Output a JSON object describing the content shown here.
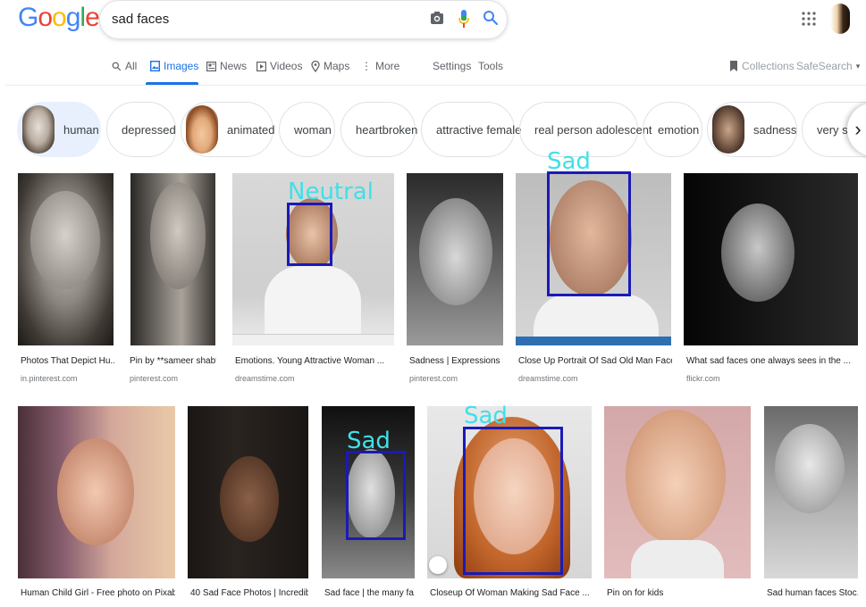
{
  "header": {
    "logo_letters": [
      "G",
      "o",
      "o",
      "g",
      "l",
      "e"
    ],
    "logo_colors": [
      "#4285f4",
      "#ea4335",
      "#fbbc05",
      "#4285f4",
      "#34a853",
      "#ea4335"
    ],
    "query": "sad faces",
    "icons": [
      "camera-icon",
      "microphone-icon",
      "search-icon",
      "apps-grid-icon"
    ]
  },
  "nav": {
    "all": "All",
    "images": "Images",
    "news": "News",
    "videos": "Videos",
    "maps": "Maps",
    "more": "More",
    "settings": "Settings",
    "tools": "Tools",
    "collections": "Collections",
    "safesearch": "SafeSearch",
    "more_glyph": "⋮",
    "safesearch_caret": "▾"
  },
  "chips": [
    "human",
    "depressed",
    "animated",
    "woman",
    "heartbroken",
    "attractive female",
    "real person adolescent",
    "emotion",
    "sadness",
    "very sad"
  ],
  "next_glyph": "›",
  "results": [
    {
      "caption": "Photos That Depict Hu...",
      "source": "in.pinterest.com"
    },
    {
      "caption": "Pin by **sameer shab*...",
      "source": "pinterest.com"
    },
    {
      "caption": "Emotions. Young Attractive Woman ...",
      "source": "dreamstime.com"
    },
    {
      "caption": "Sadness | Expressions p...",
      "source": "pinterest.com"
    },
    {
      "caption": "Close Up Portrait Of Sad Old Man Face ...",
      "source": "dreamstime.com"
    },
    {
      "caption": "What sad faces one always sees in the ...",
      "source": "flickr.com"
    },
    {
      "caption": "Human Child Girl - Free photo on Pixabay",
      "source": ""
    },
    {
      "caption": "40 Sad Face Photos | Incredibl...",
      "source": ""
    },
    {
      "caption": "Sad face | the many fa...",
      "source": ""
    },
    {
      "caption": "Closeup Of Woman Making Sad Face ...",
      "source": ""
    },
    {
      "caption": "Pin on for kids",
      "source": ""
    },
    {
      "caption": "Sad human faces Stoc...",
      "source": ""
    }
  ],
  "detections": {
    "neutral": "Neutral",
    "sad_man": "Sad",
    "sad_girl_bw": "Sad",
    "sad_redhead": "Sad"
  },
  "colors": {
    "accent": "#1a73e8",
    "detection_box": "#1a1ab8",
    "detection_label": "#3fe0e8"
  }
}
